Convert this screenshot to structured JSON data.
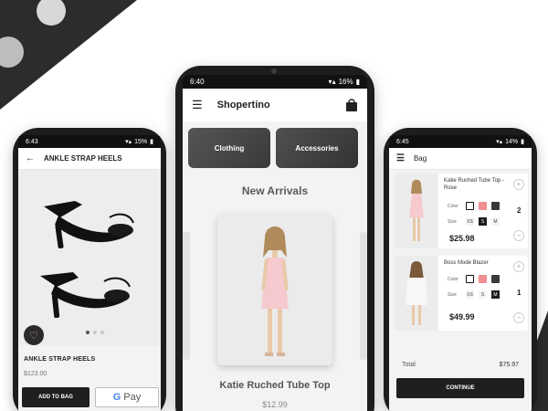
{
  "left_phone": {
    "status_time": "6:43",
    "status_battery": "15%",
    "title": "ANKLE STRAP HEELS",
    "product_name": "ANKLE STRAP HEELS",
    "price": "$123.00",
    "add_to_bag_label": "ADD TO BAG",
    "gpay_label": "Pay"
  },
  "center_phone": {
    "status_time": "6:40",
    "status_battery": "16%",
    "app_title": "Shopertino",
    "categories": [
      {
        "label": "Clothing"
      },
      {
        "label": "Accessories"
      }
    ],
    "section_title": "New Arrivals",
    "product_name": "Katie Ruched Tube Top",
    "price": "$12.99"
  },
  "right_phone": {
    "status_time": "6:45",
    "status_battery": "14%",
    "title": "Bag",
    "items": [
      {
        "name": "Katie Ruched Tube Top - Rose",
        "color_label": "Color",
        "size_label": "Size",
        "sizes": [
          "XS",
          "S",
          "M"
        ],
        "selected_size": "S",
        "quantity": "2",
        "price": "$25.98"
      },
      {
        "name": "Boss Mode Blazer",
        "color_label": "Color",
        "size_label": "Size",
        "sizes": [
          "XS",
          "S",
          "M"
        ],
        "selected_size": "M",
        "quantity": "1",
        "price": "$49.99"
      }
    ],
    "total_label": "Total",
    "total_value": "$75.97",
    "continue_label": "CONTINUE"
  },
  "colors": {
    "dark": "#1f1f1f",
    "pink": "#f08f92",
    "background": "#f3f3f3"
  }
}
